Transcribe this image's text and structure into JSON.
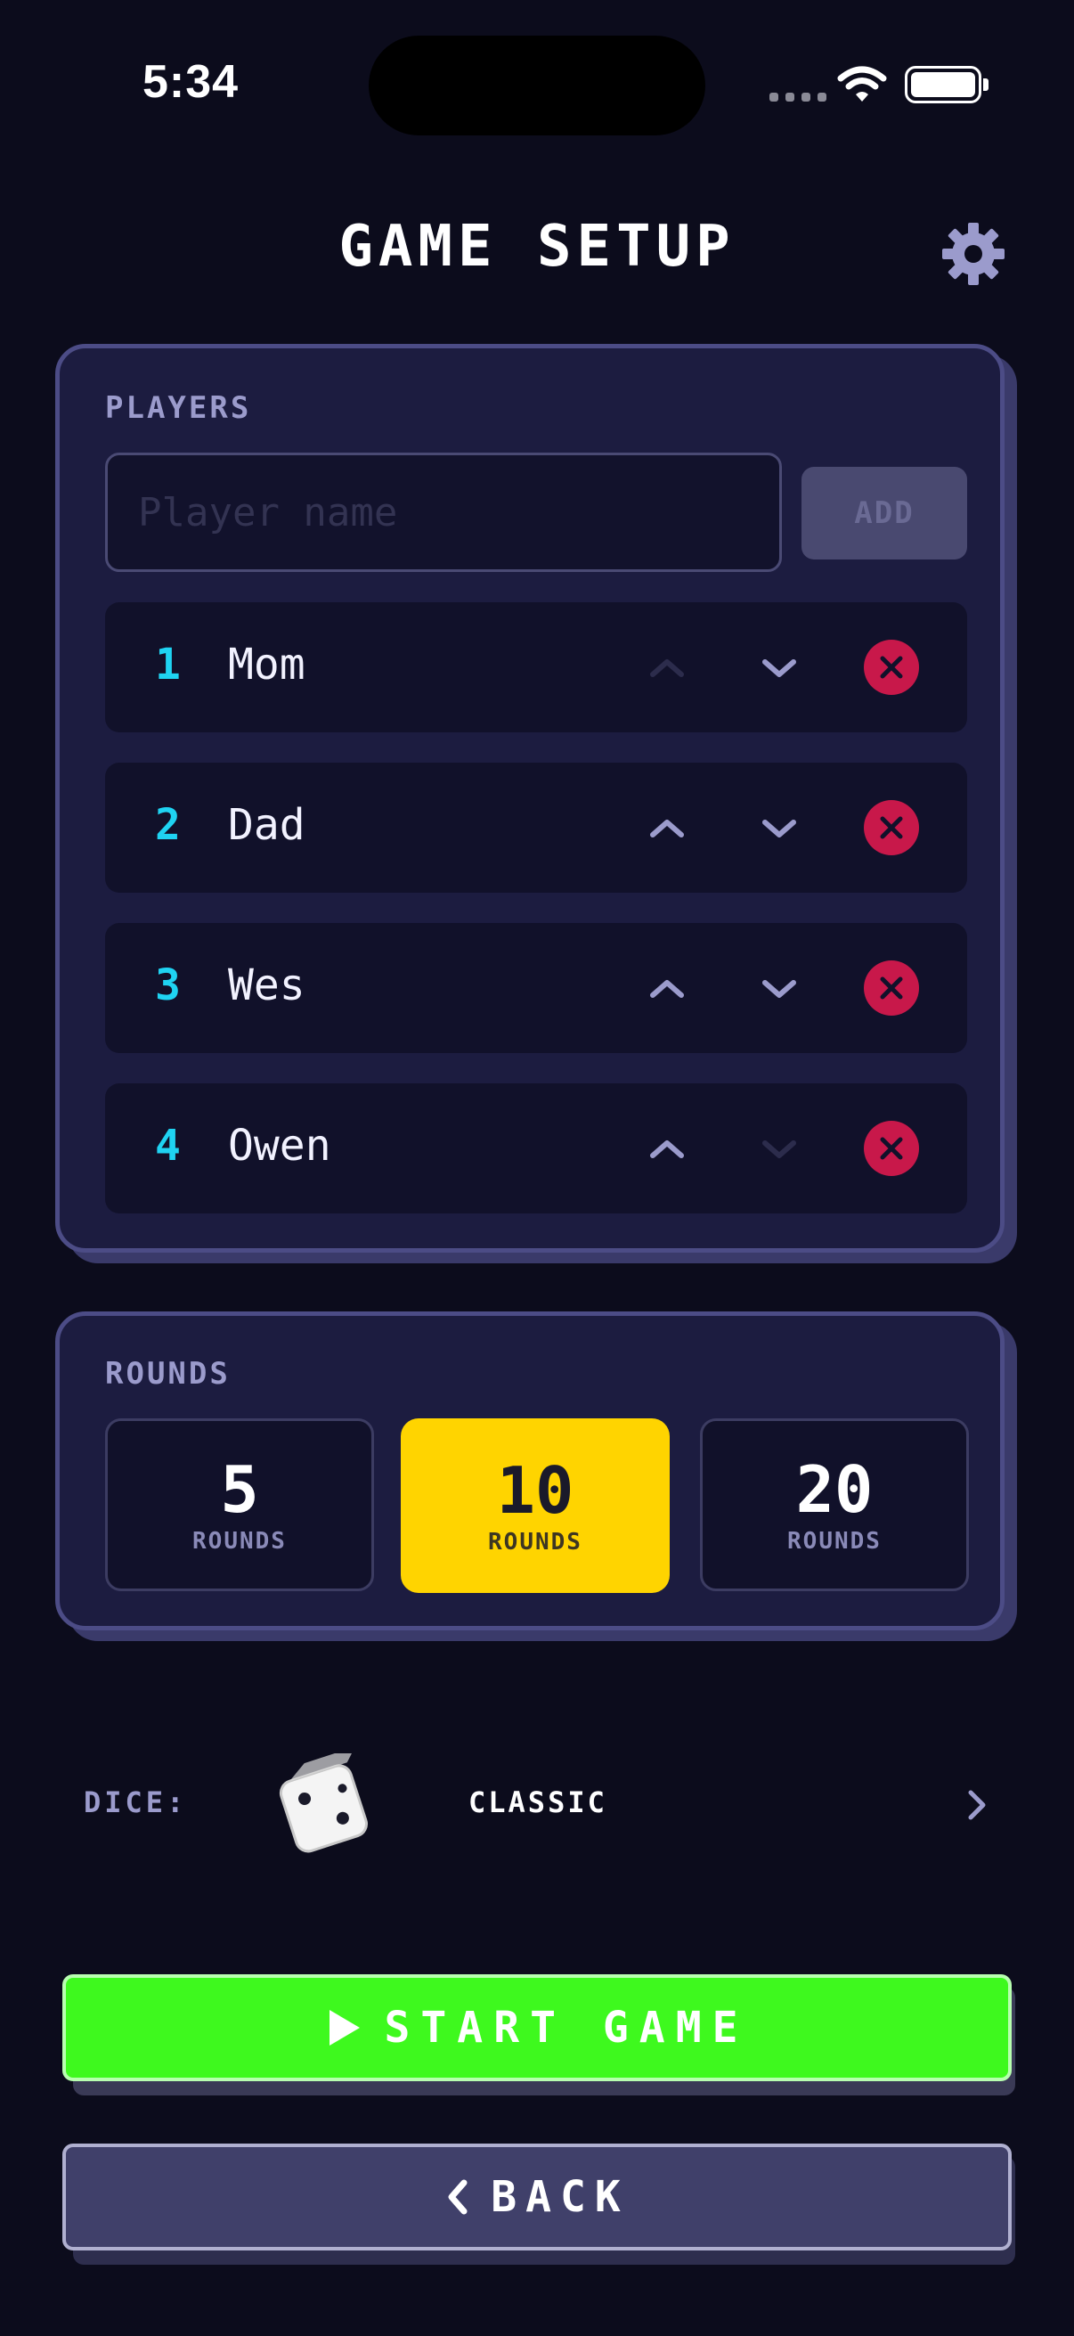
{
  "status_bar": {
    "time": "5:34"
  },
  "header": {
    "title": "GAME SETUP"
  },
  "players_section": {
    "label": "PLAYERS",
    "input_placeholder": "Player name",
    "input_value": "",
    "add_label": "ADD",
    "players": [
      {
        "number": "1",
        "name": "Mom"
      },
      {
        "number": "2",
        "name": "Dad"
      },
      {
        "number": "3",
        "name": "Wes"
      },
      {
        "number": "4",
        "name": "Owen"
      }
    ]
  },
  "rounds_section": {
    "label": "ROUNDS",
    "options": [
      {
        "value": "5",
        "word": "ROUNDS"
      },
      {
        "value": "10",
        "word": "ROUNDS"
      },
      {
        "value": "20",
        "word": "ROUNDS"
      }
    ],
    "selected": "10"
  },
  "dice": {
    "label": "DICE:",
    "name": "CLASSIC",
    "icon": "dice-icon"
  },
  "actions": {
    "start_label": "START GAME",
    "back_label": "BACK"
  },
  "colors": {
    "background": "#0c0c1c",
    "panel": "#1c1c40",
    "accent_cyan": "#1fd3f2",
    "remove_red": "#c8184a",
    "selected_yellow": "#ffd400",
    "start_green": "#3ef91e"
  }
}
